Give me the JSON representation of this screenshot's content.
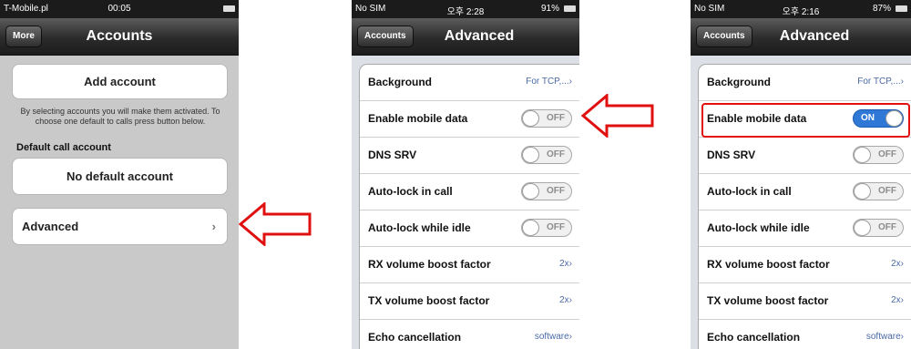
{
  "colors": {
    "accent": "#2f78d6",
    "highlight": "#e01010",
    "link": "#4a6aa6"
  },
  "screen1": {
    "status": {
      "carrier": "T-Mobile.pl",
      "time": "00:05"
    },
    "nav": {
      "back": "More",
      "title": "Accounts"
    },
    "add_account": "Add account",
    "note": "By selecting accounts you will make them activated. To choose one default to calls press button below.",
    "default_header": "Default call account",
    "no_default": "No default account",
    "advanced": "Advanced",
    "chevron": "›"
  },
  "screen2": {
    "status": {
      "carrier": "No SIM",
      "time": "오후 2:28",
      "battery": "91%"
    },
    "nav": {
      "back": "Accounts",
      "title": "Advanced"
    },
    "rows": [
      {
        "label": "Background",
        "value": "For TCP,...›"
      },
      {
        "label": "Enable mobile data",
        "toggle": "OFF"
      },
      {
        "label": "DNS SRV",
        "toggle": "OFF"
      },
      {
        "label": "Auto-lock in call",
        "toggle": "OFF"
      },
      {
        "label": "Auto-lock while idle",
        "toggle": "OFF"
      },
      {
        "label": "RX volume boost factor",
        "value": "2x›"
      },
      {
        "label": "TX volume boost factor",
        "value": "2x›"
      },
      {
        "label": "Echo cancellation",
        "value": "software›"
      }
    ]
  },
  "screen3": {
    "status": {
      "carrier": "No SIM",
      "time": "오후 2:16",
      "battery": "87%"
    },
    "nav": {
      "back": "Accounts",
      "title": "Advanced"
    },
    "rows": [
      {
        "label": "Background",
        "value": "For TCP,...›"
      },
      {
        "label": "Enable mobile data",
        "toggle": "ON"
      },
      {
        "label": "DNS SRV",
        "toggle": "OFF"
      },
      {
        "label": "Auto-lock in call",
        "toggle": "OFF"
      },
      {
        "label": "Auto-lock while idle",
        "toggle": "OFF"
      },
      {
        "label": "RX volume boost factor",
        "value": "2x›"
      },
      {
        "label": "TX volume boost factor",
        "value": "2x›"
      },
      {
        "label": "Echo cancellation",
        "value": "software›"
      }
    ]
  }
}
